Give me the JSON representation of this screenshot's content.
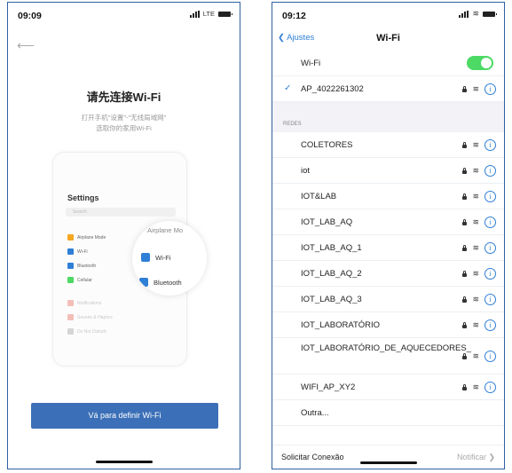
{
  "left_screen": {
    "status_time": "09:09",
    "status_network": "LTE",
    "title": "请先连接Wi-Fi",
    "instruction_line1": "打开手机\"设置\"-\"无线局域网\"",
    "instruction_line2": "选取你的家用Wi-Fi",
    "mock_settings": {
      "title": "Settings",
      "search_placeholder": "Search",
      "rows": [
        "Airplane Mode",
        "Wi-Fi",
        "Bluetooth",
        "Cellular",
        "Notifications",
        "Sounds & Haptics",
        "Do Not Disturb"
      ]
    },
    "zoom": {
      "airplane_label": "Airplane Mo",
      "wifi_label": "Wi-Fi",
      "bluetooth_label": "Bluetooth"
    },
    "action_button_label": "Vá para definir Wi-Fi"
  },
  "right_screen": {
    "status_time": "09:12",
    "back_label": "Ajustes",
    "title": "Wi-Fi",
    "wifi_toggle_label": "Wi-Fi",
    "wifi_enabled": true,
    "connected_network": "AP_4022261302",
    "section_header": "REDES",
    "networks": [
      {
        "name": "COLETORES"
      },
      {
        "name": "iot"
      },
      {
        "name": "IOT&LAB"
      },
      {
        "name": "IOT_LAB_AQ"
      },
      {
        "name": "IOT_LAB_AQ_1"
      },
      {
        "name": "IOT_LAB_AQ_2"
      },
      {
        "name": "IOT_LAB_AQ_3"
      },
      {
        "name": "IOT_LABORATÓRIO"
      },
      {
        "name": "IOT_LABORATÓRIO_DE_AQUECEDORES_"
      },
      {
        "name": "WIFI_AP_XY2"
      }
    ],
    "other_label": "Outra...",
    "bottom_label": "Solicitar Conexão",
    "bottom_value": "Notificar"
  },
  "colors": {
    "accent_blue": "#2f7fd6",
    "button_blue": "#3b6fb7",
    "toggle_green": "#4cd964",
    "frame_border": "#2f5fa3"
  }
}
